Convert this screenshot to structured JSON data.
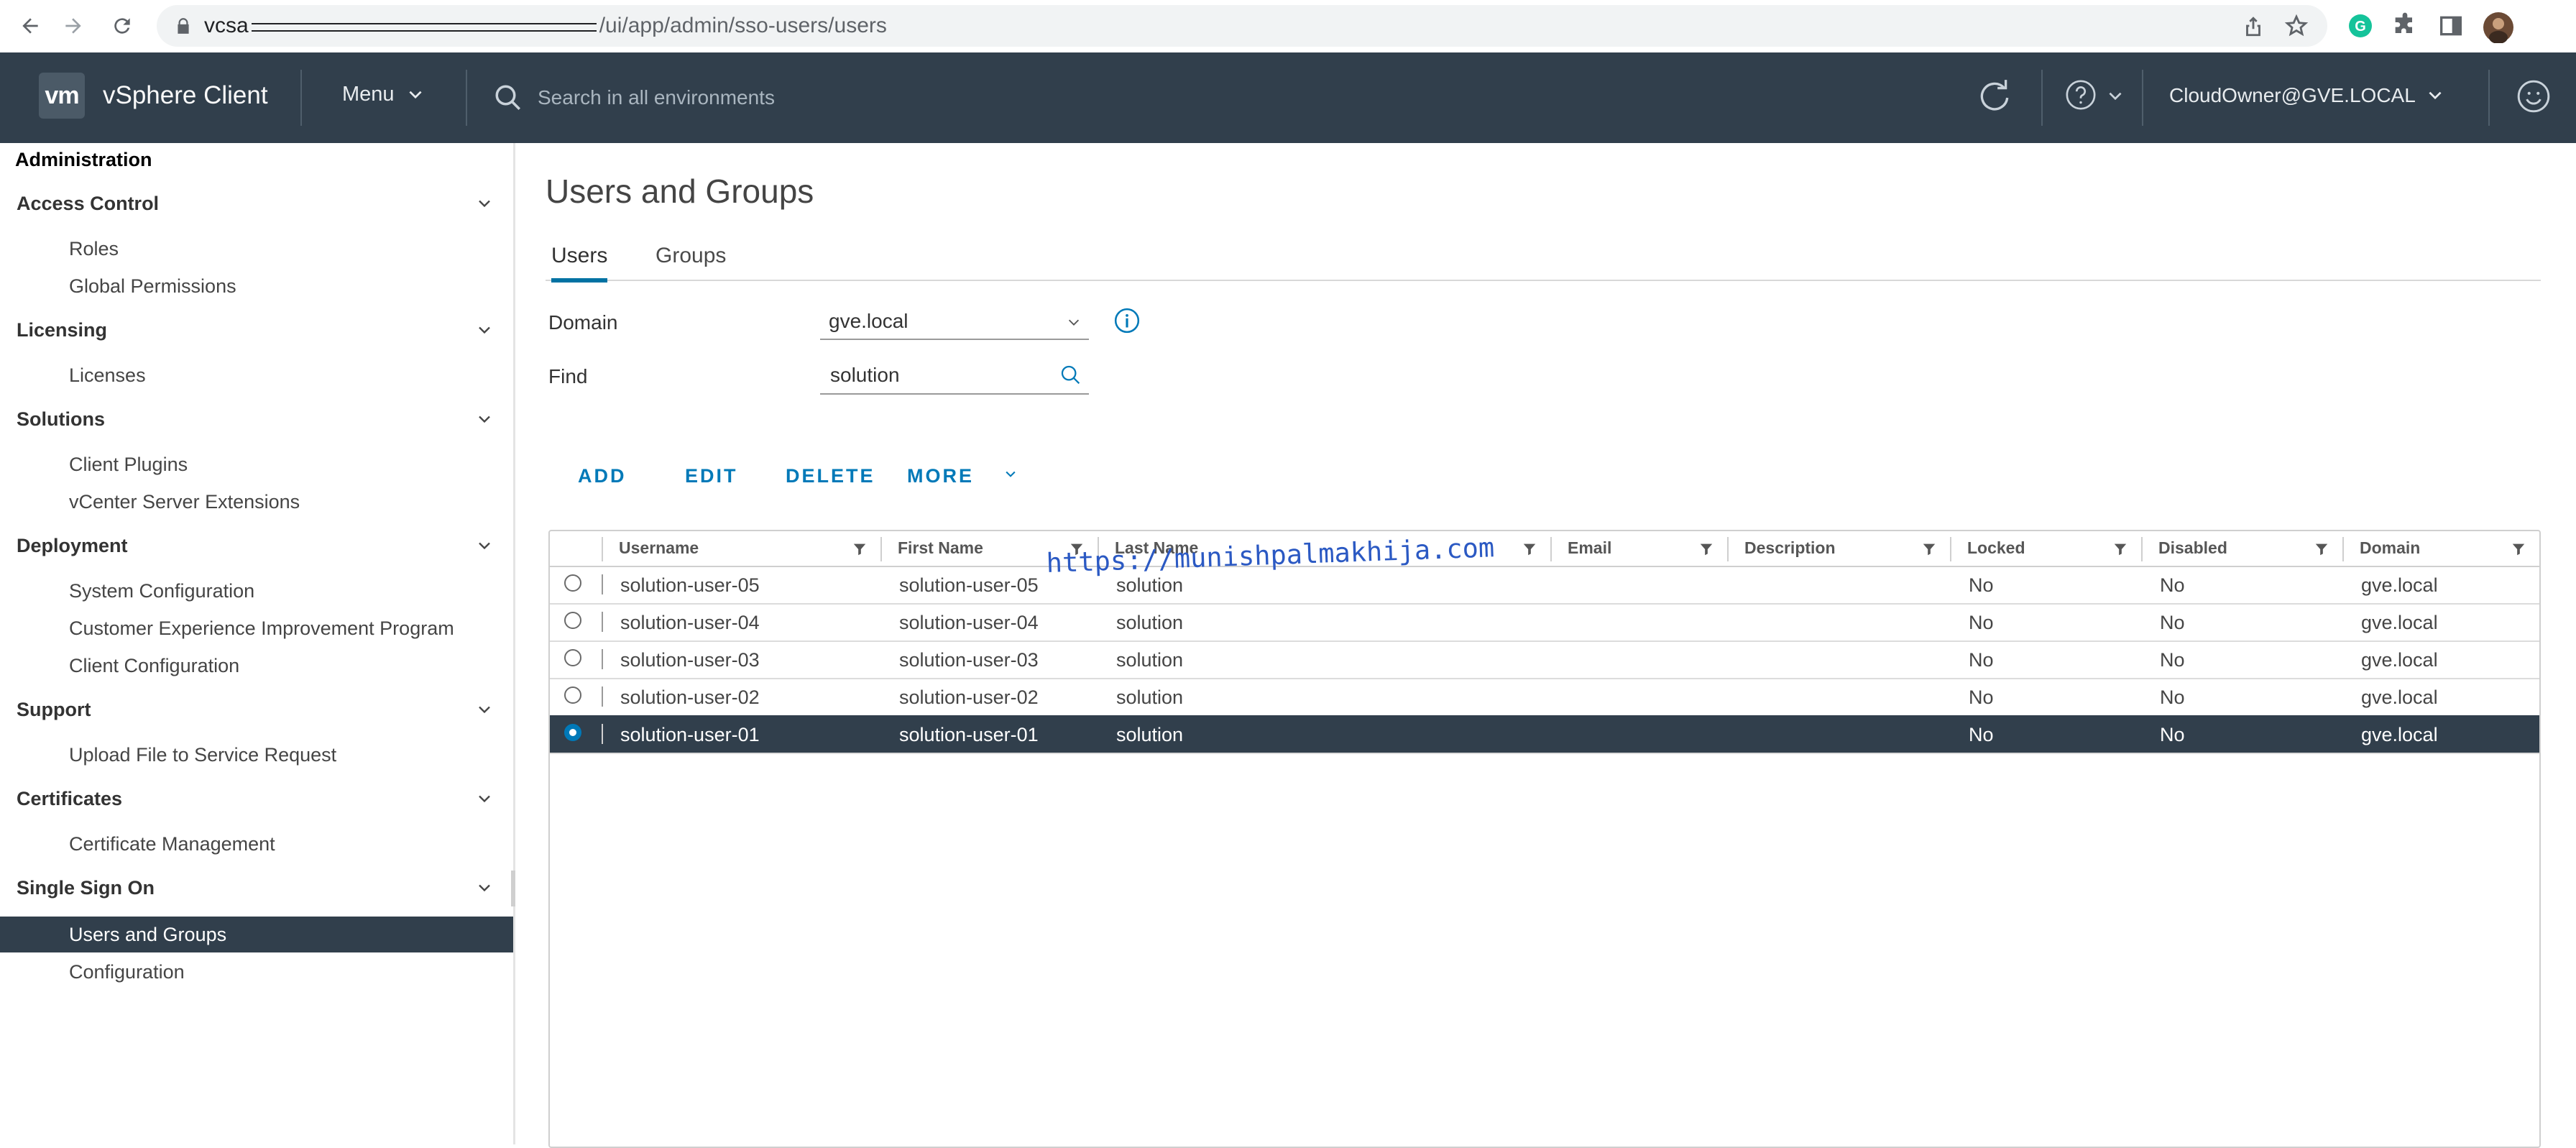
{
  "browser": {
    "url_host": "vcsa",
    "url_path": "/ui/app/admin/sso-users/users"
  },
  "header": {
    "logo": "vm",
    "app_title": "vSphere Client",
    "menu_label": "Menu",
    "search_placeholder": "Search in all environments",
    "user": "CloudOwner@GVE.LOCAL"
  },
  "sidebar": {
    "title": "Administration",
    "groups": [
      {
        "label": "Access Control",
        "items": [
          "Roles",
          "Global Permissions"
        ]
      },
      {
        "label": "Licensing",
        "items": [
          "Licenses"
        ]
      },
      {
        "label": "Solutions",
        "items": [
          "Client Plugins",
          "vCenter Server Extensions"
        ]
      },
      {
        "label": "Deployment",
        "items": [
          "System Configuration",
          "Customer Experience Improvement Program",
          "Client Configuration"
        ]
      },
      {
        "label": "Support",
        "items": [
          "Upload File to Service Request"
        ]
      },
      {
        "label": "Certificates",
        "items": [
          "Certificate Management"
        ]
      },
      {
        "label": "Single Sign On",
        "items": [
          "Users and Groups",
          "Configuration"
        ]
      }
    ],
    "active_item": "Users and Groups"
  },
  "main": {
    "page_title": "Users and Groups",
    "tabs": [
      {
        "label": "Users",
        "active": true
      },
      {
        "label": "Groups",
        "active": false
      }
    ],
    "domain_label": "Domain",
    "domain_value": "gve.local",
    "find_label": "Find",
    "find_value": "solution",
    "actions": [
      "ADD",
      "EDIT",
      "DELETE",
      "MORE"
    ],
    "grid": {
      "columns": [
        "Username",
        "First Name",
        "Last Name",
        "Email",
        "Description",
        "Locked",
        "Disabled",
        "Domain"
      ],
      "rows": [
        {
          "username": "solution-user-05",
          "first_name": "solution-user-05",
          "last_name": "solution",
          "email": "",
          "description": "",
          "locked": "No",
          "disabled": "No",
          "domain": "gve.local",
          "selected": false
        },
        {
          "username": "solution-user-04",
          "first_name": "solution-user-04",
          "last_name": "solution",
          "email": "",
          "description": "",
          "locked": "No",
          "disabled": "No",
          "domain": "gve.local",
          "selected": false
        },
        {
          "username": "solution-user-03",
          "first_name": "solution-user-03",
          "last_name": "solution",
          "email": "",
          "description": "",
          "locked": "No",
          "disabled": "No",
          "domain": "gve.local",
          "selected": false
        },
        {
          "username": "solution-user-02",
          "first_name": "solution-user-02",
          "last_name": "solution",
          "email": "",
          "description": "",
          "locked": "No",
          "disabled": "No",
          "domain": "gve.local",
          "selected": false
        },
        {
          "username": "solution-user-01",
          "first_name": "solution-user-01",
          "last_name": "solution",
          "email": "",
          "description": "",
          "locked": "No",
          "disabled": "No",
          "domain": "gve.local",
          "selected": true
        }
      ]
    },
    "watermark": "https://munishpalmakhija.com"
  },
  "colors": {
    "header_bg": "#313f4c",
    "accent_blue": "#0079b8",
    "selected_row": "#313f4c"
  }
}
